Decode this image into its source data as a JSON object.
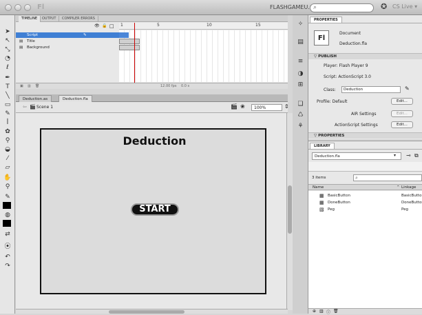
{
  "window": {
    "app_logo": "Fl",
    "workspace": "FLASHGAMEU.COM ▾",
    "cs_live": "CS Live ▾"
  },
  "timeline": {
    "tabs": [
      "TIMELINE",
      "OUTPUT",
      "COMPILER ERRORS"
    ],
    "ruler": [
      "1",
      "5",
      "10",
      "15"
    ],
    "layers": [
      {
        "name": "Script"
      },
      {
        "name": "Title"
      },
      {
        "name": "Background"
      }
    ],
    "footer": {
      "fps": "12.00 fps",
      "time": "0.0 s"
    }
  },
  "document_tabs": [
    "Deduction.as",
    "Deduction.fla"
  ],
  "edit_bar": {
    "scene": "Scene 1",
    "zoom": "100%"
  },
  "stage": {
    "title": "Deduction",
    "start_button": "START"
  },
  "properties": {
    "tab": "PROPERTIES",
    "fl_logo": "Fl",
    "doc_kind": "Document",
    "doc_name": "Deduction.fla",
    "publish_header": "PUBLISH",
    "player_label": "Player:",
    "player_value": "Flash Player 9",
    "script_label": "Script:",
    "script_value": "ActionScript 3.0",
    "class_label": "Class:",
    "class_value": "Deduction",
    "profile_label": "Profile:",
    "profile_value": "Default",
    "edit_label": "Edit...",
    "air_label": "AIR Settings",
    "as_label": "ActionScript Settings",
    "properties_header": "PROPERTIES"
  },
  "library": {
    "tab": "LIBRARY",
    "selected": "Deduction.fla",
    "count": "3 items",
    "col_name": "Name",
    "col_linkage": "Linkage",
    "items": [
      {
        "name": "BasicButton",
        "linkage": "BasicButton"
      },
      {
        "name": "DoneButton",
        "linkage": "DoneButton"
      },
      {
        "name": "Peg",
        "linkage": "Peg"
      }
    ]
  }
}
